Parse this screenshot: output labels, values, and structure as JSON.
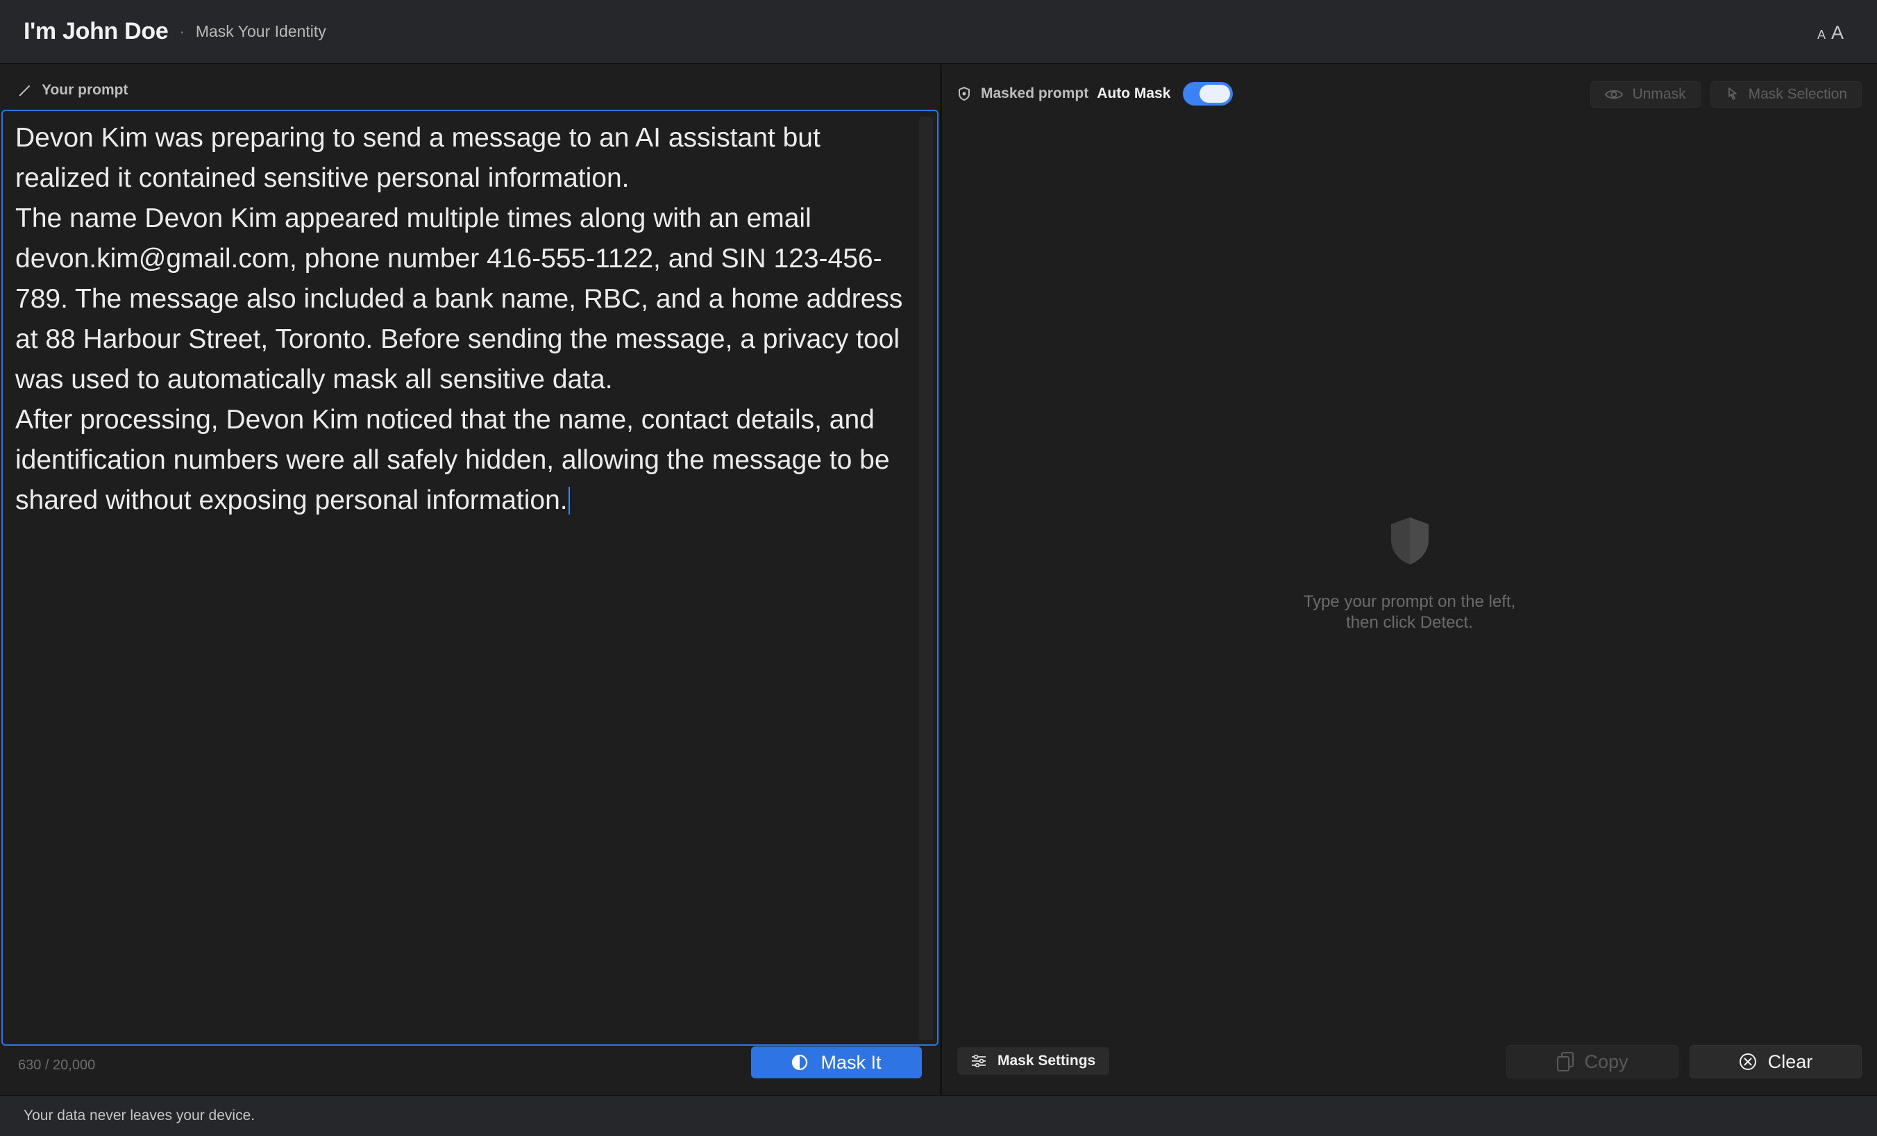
{
  "header": {
    "title": "I'm John Doe",
    "separator": "·",
    "subtitle": "Mask Your Identity",
    "font_small_label": "A",
    "font_large_label": "A"
  },
  "left_pane": {
    "label": "Your prompt",
    "paragraphs": [
      "Devon Kim was preparing to send a message to an AI assistant but realized it contained sensitive personal information.",
      "The name Devon Kim appeared multiple times along with an email devon.kim@gmail.com, phone number 416-555-1122, and SIN 123-456-789. The message also included a bank name, RBC, and a home address at 88 Harbour Street, Toronto. Before sending the message, a privacy tool was used to automatically mask all sensitive data.",
      "After processing, Devon Kim noticed that the name, contact details, and identification numbers were all safely hidden, allowing the message to be shared without exposing personal information."
    ],
    "char_count": "630 / 20,000",
    "mask_button_label": "Mask It"
  },
  "right_pane": {
    "label": "Masked prompt",
    "auto_mask_label": "Auto Mask",
    "auto_mask_on": true,
    "unmask_label": "Unmask",
    "mask_selection_label": "Mask Selection",
    "empty_line1": "Type your prompt on the left,",
    "empty_line2": "then click Detect.",
    "mask_settings_label": "Mask Settings",
    "copy_label": "Copy",
    "clear_label": "Clear"
  },
  "footer": {
    "text": "Your data never leaves your device."
  },
  "colors": {
    "accent": "#2f74e3",
    "toggle_on": "#3b82f6",
    "background": "#1e1e1e",
    "header_bg": "#25272a"
  },
  "icons": {
    "prompt_label_icon": "pencil-icon",
    "masked_label_icon": "shield-icon",
    "unmask_icon": "eye-icon",
    "mask_selection_icon": "cursor-mask-icon",
    "empty_state_icon": "shield-icon",
    "mask_button_icon": "half-shield-icon",
    "settings_icon": "sliders-icon",
    "copy_icon": "copy-icon",
    "clear_icon": "close-circle-icon"
  }
}
